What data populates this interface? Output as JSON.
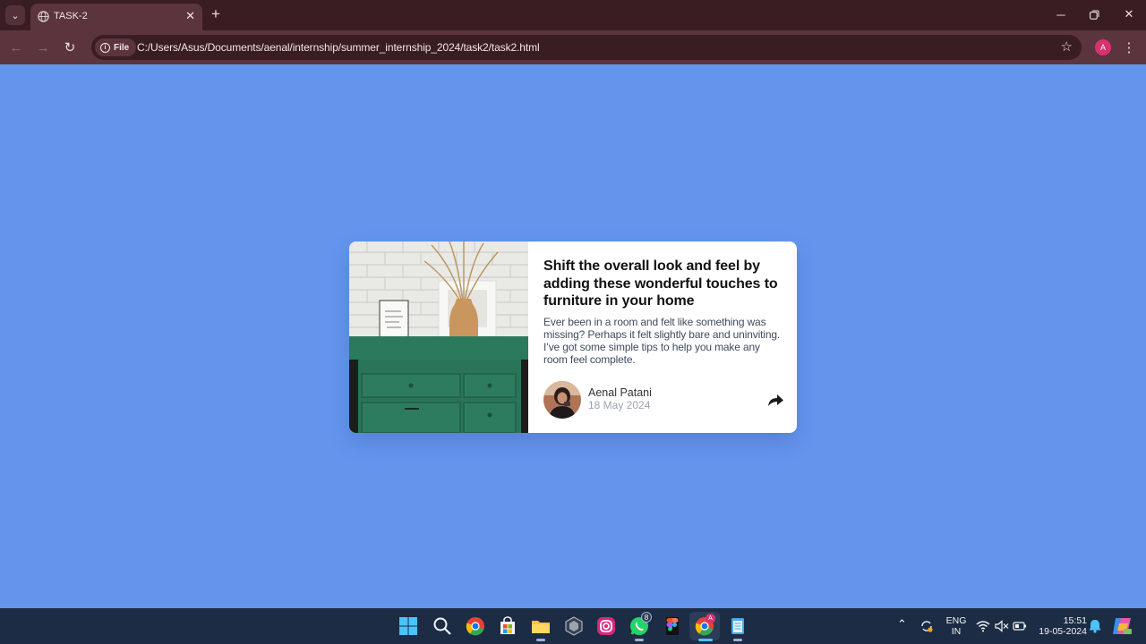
{
  "browser": {
    "tab_title": "TASK-2",
    "url_chip": "File",
    "url": "C:/Users/Asus/Documents/aenal/internship/summer_internship_2024/task2/task2.html",
    "profile_initial": "A",
    "icons": [
      "chevron-down-icon",
      "globe-icon",
      "close-icon",
      "plus-icon",
      "back-icon",
      "forward-icon",
      "reload-icon",
      "info-icon",
      "star-icon",
      "more-icon",
      "minimize-icon",
      "restore-icon"
    ]
  },
  "page": {
    "background": "#6495ed"
  },
  "card": {
    "title": "Shift the overall look and feel by adding these wonderful touches to furniture in your home",
    "excerpt": "Ever been in a room and felt like something was missing? Perhaps it felt slightly bare and uninviting. I’ve got some simple tips to help you make any room feel complete.",
    "author_name": "Aenal Patani",
    "date": "18 May 2024",
    "share_icon": "share-icon"
  },
  "taskbar": {
    "apps": [
      "windows-start-icon",
      "search-icon",
      "chrome-icon",
      "store-icon",
      "file-explorer-icon",
      "app-icon",
      "instagram-icon",
      "whatsapp-icon",
      "figma-icon",
      "chrome-active-icon",
      "notepad-icon"
    ],
    "whatsapp_badge": "8",
    "chrome_badge": "A",
    "language_line1": "ENG",
    "language_line2": "IN",
    "time": "15:51",
    "date": "19-05-2024"
  }
}
